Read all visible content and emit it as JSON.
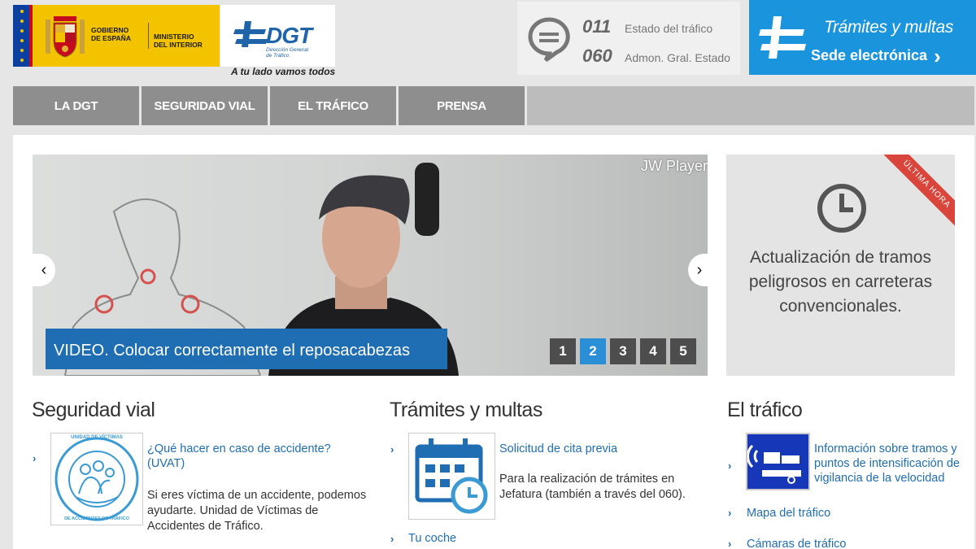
{
  "header": {
    "gov_line1": "GOBIERNO",
    "gov_line2": "DE ESPAÑA",
    "min_line1": "MINISTERIO",
    "min_line2": "DEL INTERIOR",
    "dgt_name": "DGT",
    "dgt_sub1": "Dirección General",
    "dgt_sub2": "de Tráfico",
    "tagline": "A tu lado vamos todos",
    "phones": [
      {
        "num": "011",
        "label": "Estado del tráfico"
      },
      {
        "num": "060",
        "label": "Admon. Gral. Estado"
      }
    ],
    "sede_title": "Trámites y multas",
    "sede_sub": "Sede electrónica",
    "sede_chevron": "›"
  },
  "nav": [
    {
      "label": "LA DGT"
    },
    {
      "label": "SEGURIDAD VIAL"
    },
    {
      "label": "EL TRÁFICO"
    },
    {
      "label": "PRENSA"
    }
  ],
  "slider": {
    "player_label": "JW Player",
    "caption": "VIDEO. Colocar correctamente el reposacabezas",
    "pages": [
      "1",
      "2",
      "3",
      "4",
      "5"
    ],
    "active_page": "2",
    "prev": "‹",
    "next": "›"
  },
  "news": {
    "ribbon": "ÚLTIMA HORA",
    "line1": "Actualización de tramos",
    "line2": "peligrosos en carreteras",
    "line3": "convencionales."
  },
  "sections": {
    "seguridad": {
      "title": "Seguridad vial",
      "link": "¿Qué hacer en caso de accidente? (UVAT)",
      "desc": "Si eres víctima de un accidente, podemos ayudarte. Unidad de Víctimas de Accidentes de Tráfico.",
      "badge_top": "UNIDAD DE VÍCTIMAS",
      "badge_bottom": "DE ACCIDENTES DE TRÁFICO"
    },
    "tramites": {
      "title": "Trámites y multas",
      "link": "Solicitud de cita previa",
      "desc": "Para la realización de trámites en Jefatura (también a través del 060).",
      "link2": "Tu coche"
    },
    "trafico": {
      "title": "El tráfico",
      "link": "Información sobre tramos y puntos de intensificación de vigilancia de la velocidad",
      "link2": "Mapa del tráfico",
      "link3": "Cámaras de tráfico"
    }
  },
  "colors": {
    "accent_blue": "#1a94dc",
    "link_blue": "#1f6eb3",
    "nav_gray": "#8e8e8e",
    "ribbon_red": "#d9453a",
    "gov_yellow": "#f3c300"
  },
  "chevron": "›"
}
